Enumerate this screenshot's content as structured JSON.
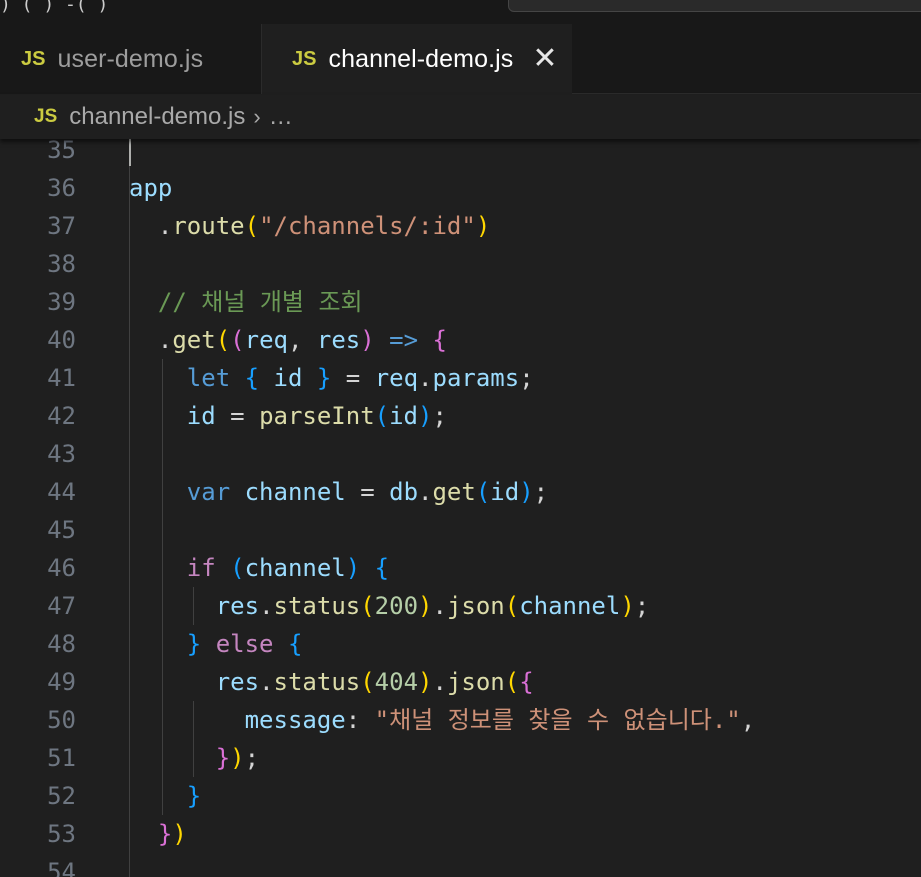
{
  "topbar": {
    "fragment": ")      (  )      -( )"
  },
  "tabs": [
    {
      "icon": "JS",
      "label": "user-demo.js",
      "active": false
    },
    {
      "icon": "JS",
      "label": "channel-demo.js",
      "active": true,
      "close": "✕"
    }
  ],
  "breadcrumb": {
    "icon": "JS",
    "file": "channel-demo.js",
    "separator": "›",
    "more": "…"
  },
  "editor": {
    "line_numbers": [
      "35",
      "36",
      "37",
      "38",
      "39",
      "40",
      "41",
      "42",
      "43",
      "44",
      "45",
      "46",
      "47",
      "48",
      "49",
      "50",
      "51",
      "52",
      "53",
      "54"
    ],
    "lines": [
      [],
      [
        [
          "app",
          "t-var"
        ]
      ],
      [
        [
          "  .",
          "t-pun"
        ],
        [
          "route",
          "t-fn"
        ],
        [
          "(",
          "b1"
        ],
        [
          "\"/channels/:id\"",
          "t-str"
        ],
        [
          ")",
          "b1"
        ]
      ],
      [],
      [
        [
          "  // 채널 개별 조회",
          "t-cmt"
        ]
      ],
      [
        [
          "  .",
          "t-pun"
        ],
        [
          "get",
          "t-fn"
        ],
        [
          "(",
          "b1"
        ],
        [
          "(",
          "b2"
        ],
        [
          "req",
          "t-var"
        ],
        [
          ", ",
          "t-pun"
        ],
        [
          "res",
          "t-var"
        ],
        [
          ")",
          "b2"
        ],
        [
          " ",
          "t-pun"
        ],
        [
          "=>",
          "t-kw"
        ],
        [
          " ",
          "t-pun"
        ],
        [
          "{",
          "b2"
        ]
      ],
      [
        [
          "    ",
          "t-pun"
        ],
        [
          "let",
          "t-kw"
        ],
        [
          " ",
          "t-pun"
        ],
        [
          "{",
          "b3"
        ],
        [
          " ",
          "t-pun"
        ],
        [
          "id",
          "t-var"
        ],
        [
          " ",
          "t-pun"
        ],
        [
          "}",
          "b3"
        ],
        [
          " = ",
          "t-pun"
        ],
        [
          "req",
          "t-var"
        ],
        [
          ".",
          "t-pun"
        ],
        [
          "params",
          "t-var"
        ],
        [
          ";",
          "t-pun"
        ]
      ],
      [
        [
          "    ",
          "t-pun"
        ],
        [
          "id",
          "t-var"
        ],
        [
          " = ",
          "t-pun"
        ],
        [
          "parseInt",
          "t-fn"
        ],
        [
          "(",
          "b3"
        ],
        [
          "id",
          "t-var"
        ],
        [
          ")",
          "b3"
        ],
        [
          ";",
          "t-pun"
        ]
      ],
      [],
      [
        [
          "    ",
          "t-pun"
        ],
        [
          "var",
          "t-kw"
        ],
        [
          " ",
          "t-pun"
        ],
        [
          "channel",
          "t-var"
        ],
        [
          " = ",
          "t-pun"
        ],
        [
          "db",
          "t-var"
        ],
        [
          ".",
          "t-pun"
        ],
        [
          "get",
          "t-fn"
        ],
        [
          "(",
          "b3"
        ],
        [
          "id",
          "t-var"
        ],
        [
          ")",
          "b3"
        ],
        [
          ";",
          "t-pun"
        ]
      ],
      [],
      [
        [
          "    ",
          "t-pun"
        ],
        [
          "if",
          "t-ctl"
        ],
        [
          " ",
          "t-pun"
        ],
        [
          "(",
          "b3"
        ],
        [
          "channel",
          "t-var"
        ],
        [
          ")",
          "b3"
        ],
        [
          " ",
          "t-pun"
        ],
        [
          "{",
          "b3"
        ]
      ],
      [
        [
          "      ",
          "t-pun"
        ],
        [
          "res",
          "t-var"
        ],
        [
          ".",
          "t-pun"
        ],
        [
          "status",
          "t-fn"
        ],
        [
          "(",
          "b1"
        ],
        [
          "200",
          "t-num"
        ],
        [
          ")",
          "b1"
        ],
        [
          ".",
          "t-pun"
        ],
        [
          "json",
          "t-fn"
        ],
        [
          "(",
          "b1"
        ],
        [
          "channel",
          "t-var"
        ],
        [
          ")",
          "b1"
        ],
        [
          ";",
          "t-pun"
        ]
      ],
      [
        [
          "    ",
          "t-pun"
        ],
        [
          "}",
          "b3"
        ],
        [
          " ",
          "t-pun"
        ],
        [
          "else",
          "t-ctl"
        ],
        [
          " ",
          "t-pun"
        ],
        [
          "{",
          "b3"
        ]
      ],
      [
        [
          "      ",
          "t-pun"
        ],
        [
          "res",
          "t-var"
        ],
        [
          ".",
          "t-pun"
        ],
        [
          "status",
          "t-fn"
        ],
        [
          "(",
          "b1"
        ],
        [
          "404",
          "t-num"
        ],
        [
          ")",
          "b1"
        ],
        [
          ".",
          "t-pun"
        ],
        [
          "json",
          "t-fn"
        ],
        [
          "(",
          "b1"
        ],
        [
          "{",
          "b2"
        ]
      ],
      [
        [
          "        ",
          "t-pun"
        ],
        [
          "message",
          "t-var"
        ],
        [
          ": ",
          "t-pun"
        ],
        [
          "\"채널 정보를 찾을 수 없습니다.\"",
          "t-str"
        ],
        [
          ",",
          "t-pun"
        ]
      ],
      [
        [
          "      ",
          "t-pun"
        ],
        [
          "}",
          "b2"
        ],
        [
          ")",
          "b1"
        ],
        [
          ";",
          "t-pun"
        ]
      ],
      [
        [
          "    ",
          "t-pun"
        ],
        [
          "}",
          "b3"
        ]
      ],
      [
        [
          "  ",
          "t-pun"
        ],
        [
          "}",
          "b2"
        ],
        [
          ")",
          "b1"
        ]
      ],
      []
    ]
  }
}
